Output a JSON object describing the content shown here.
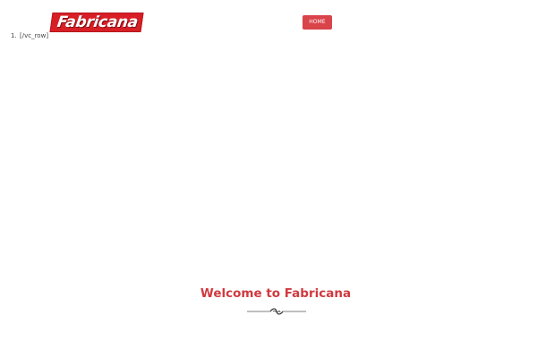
{
  "header": {
    "logo_text": "Fabricana",
    "nav": {
      "home_label": "HOME"
    }
  },
  "content": {
    "list_items": [
      {
        "number": "1.",
        "text": "[/vc_row]"
      }
    ],
    "welcome_heading": "Welcome to Fabricana"
  },
  "colors": {
    "brand_red": "#d81f26",
    "nav_button": "#d9434a",
    "heading": "#d0393f"
  },
  "icons": {
    "divider": "ornamental-divider-icon"
  }
}
